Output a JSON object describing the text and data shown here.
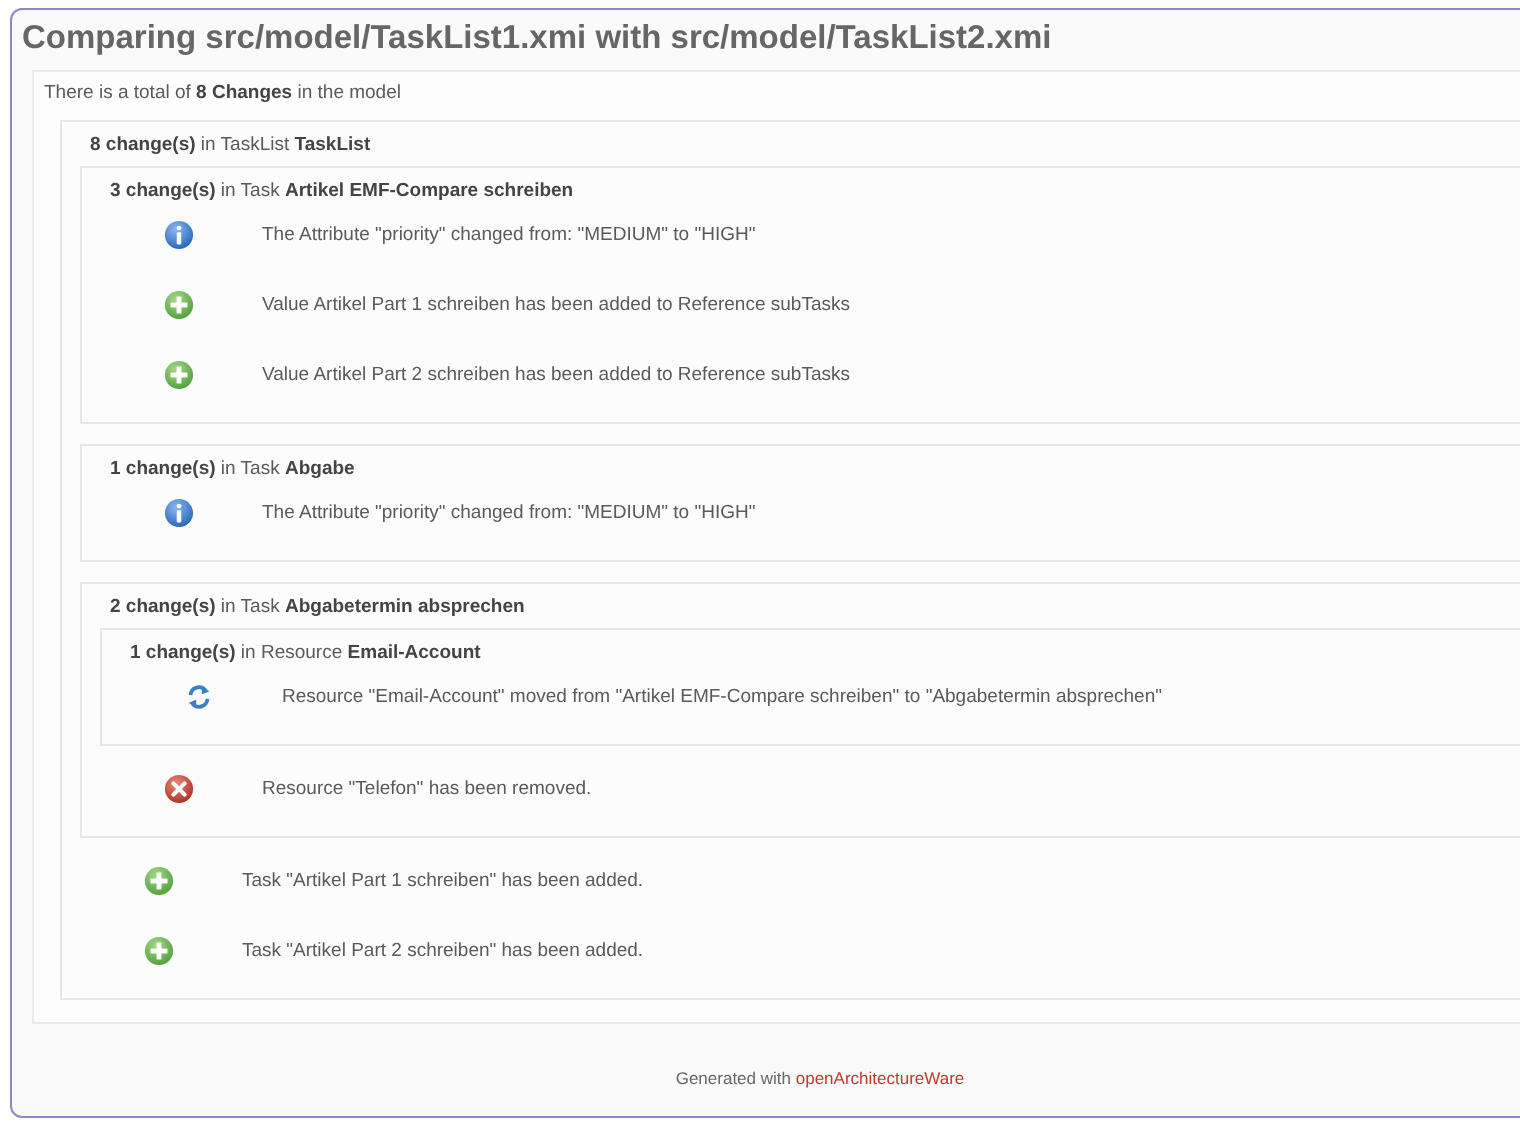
{
  "title": "Comparing src/model/TaskList1.xmi with src/model/TaskList2.xmi",
  "summary": "There is a total of **8 Changes** in the model",
  "root": {
    "kind": "group",
    "header": "**8 change(s)** in TaskList **TaskList**",
    "children": [
      {
        "kind": "group",
        "header": "**3 change(s)** in Task **Artikel EMF-Compare schreiben**",
        "children": [
          {
            "kind": "changed",
            "text": "The Attribute \"priority\" changed from: \"MEDIUM\" to \"HIGH\""
          },
          {
            "kind": "added",
            "text": "Value Artikel Part 1 schreiben has been added to Reference subTasks"
          },
          {
            "kind": "added",
            "text": "Value Artikel Part 2 schreiben has been added to Reference subTasks"
          }
        ]
      },
      {
        "kind": "group",
        "header": "**1 change(s)** in Task **Abgabe**",
        "children": [
          {
            "kind": "changed",
            "text": "The Attribute \"priority\" changed from: \"MEDIUM\" to \"HIGH\""
          }
        ]
      },
      {
        "kind": "group",
        "header": "**2 change(s)** in Task **Abgabetermin absprechen**",
        "children": [
          {
            "kind": "group",
            "header": "**1 change(s)** in Resource **Email-Account**",
            "children": [
              {
                "kind": "moved",
                "text": "Resource \"Email-Account\" moved from \"Artikel EMF-Compare schreiben\" to \"Abgabetermin absprechen\""
              }
            ]
          },
          {
            "kind": "removed",
            "text": "Resource \"Telefon\" has been removed."
          }
        ]
      },
      {
        "kind": "added",
        "text": "Task \"Artikel Part 1 schreiben\" has been added."
      },
      {
        "kind": "added",
        "text": "Task \"Artikel Part 2 schreiben\" has been added."
      }
    ]
  },
  "footer": {
    "text": "Generated with",
    "link": "openArchitectureWare"
  }
}
